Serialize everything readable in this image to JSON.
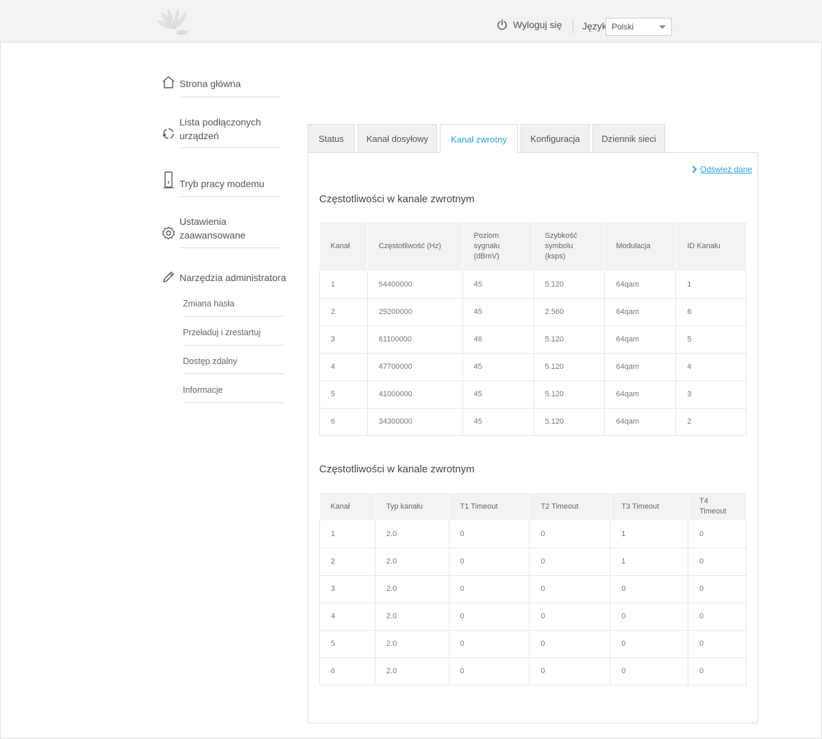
{
  "header": {
    "logo_text": "upc",
    "logout_label": "Wyloguj się",
    "language_label": "Język",
    "language_value": "Polski"
  },
  "sidebar": {
    "items": [
      {
        "label": "Strona główna"
      },
      {
        "label": "Lista podłączonych urządzeń"
      },
      {
        "label": "Tryb pracy modemu"
      },
      {
        "label": "Ustawienia zaawansowane"
      },
      {
        "label": "Narzędzia administratora"
      }
    ],
    "sub_items": [
      {
        "label": "Zmiana hasła"
      },
      {
        "label": "Przeładuj i zrestartuj"
      },
      {
        "label": "Dostęp zdalny"
      },
      {
        "label": "Informacje"
      }
    ]
  },
  "tabs": [
    {
      "label": "Status"
    },
    {
      "label": "Kanał dosyłowy"
    },
    {
      "label": "Kanał zwrotny",
      "active": true
    },
    {
      "label": "Konfiguracja"
    },
    {
      "label": "Dziennik sieci"
    }
  ],
  "refresh_label": "Odśwież dane",
  "section1": {
    "title": "Częstotliwości w kanale zwrotnym",
    "headers": [
      "Kanał",
      "Częstotliwość (Hz)",
      "Poziom sygnału (dBmV)",
      "Szybkość symbolu (ksps)",
      "Modulacja",
      "ID Kanału"
    ],
    "rows": [
      [
        "1",
        "54400000",
        "45",
        "5.120",
        "64qam",
        "1"
      ],
      [
        "2",
        "29200000",
        "45",
        "2.560",
        "64qam",
        "6"
      ],
      [
        "3",
        "61100000",
        "46",
        "5.120",
        "64qam",
        "5"
      ],
      [
        "4",
        "47700000",
        "45",
        "5.120",
        "64qam",
        "4"
      ],
      [
        "5",
        "41000000",
        "45",
        "5.120",
        "64qam",
        "3"
      ],
      [
        "6",
        "34300000",
        "45",
        "5.120",
        "64qam",
        "2"
      ]
    ]
  },
  "section2": {
    "title": "Częstotliwości w kanale zwrotnym",
    "headers": [
      "Kanał",
      "Typ kanału",
      "T1 Timeout",
      "T2 Timeout",
      "T3 Timeout",
      "T4 Timeout"
    ],
    "rows": [
      [
        "1",
        "2.0",
        "0",
        "0",
        "1",
        "0"
      ],
      [
        "2",
        "2.0",
        "0",
        "0",
        "1",
        "0"
      ],
      [
        "3",
        "2.0",
        "0",
        "0",
        "0",
        "0"
      ],
      [
        "4",
        "2.0",
        "0",
        "0",
        "0",
        "0"
      ],
      [
        "5",
        "2.0",
        "0",
        "0",
        "0",
        "0"
      ],
      [
        "6",
        "2.0",
        "0",
        "0",
        "0",
        "0"
      ]
    ]
  },
  "colors": {
    "accent": "#2aa3d7",
    "header_bg": "#f2f2f2",
    "table_header_bg": "#f2f2f2"
  }
}
